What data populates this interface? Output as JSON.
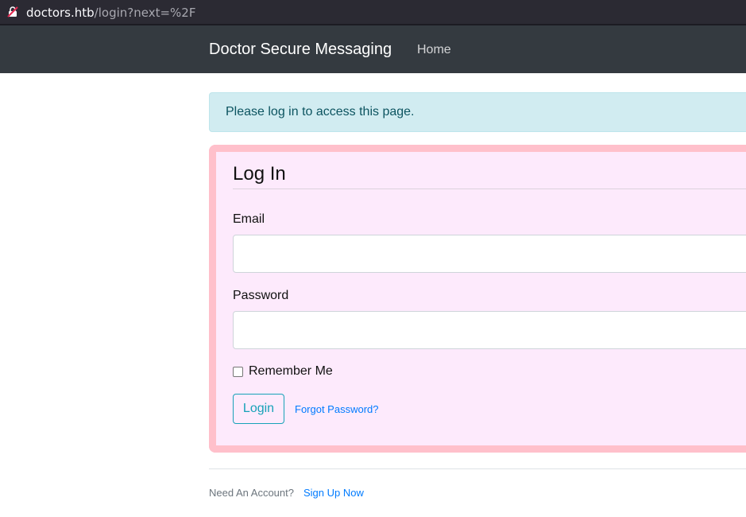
{
  "browser": {
    "url_host": "doctors.htb",
    "url_path": "/login?next=%2F"
  },
  "navbar": {
    "brand": "Doctor Secure Messaging",
    "links": [
      "Home"
    ]
  },
  "alert": {
    "message": "Please log in to access this page."
  },
  "form": {
    "legend": "Log In",
    "email_label": "Email",
    "email_value": "",
    "password_label": "Password",
    "password_value": "",
    "remember_label": "Remember Me",
    "remember_checked": false,
    "submit_label": "Login",
    "forgot_label": "Forgot Password?"
  },
  "footer": {
    "prompt": "Need An Account?",
    "signup_label": "Sign Up Now"
  },
  "colors": {
    "navbar_bg": "#343a40",
    "alert_bg": "#d1ecf1",
    "card_bg": "#fdeafc",
    "card_border": "#ffc0cb",
    "accent": "#17a2b8",
    "link": "#007bff"
  },
  "icons": {
    "url_lock": "insecure-lock-icon"
  }
}
